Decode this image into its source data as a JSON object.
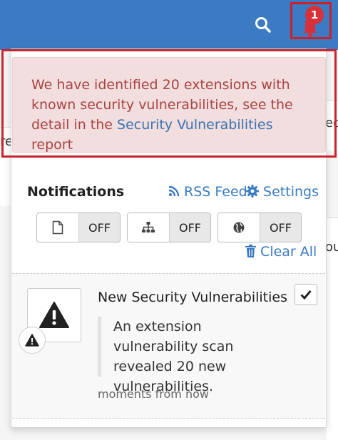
{
  "topbar": {
    "search_icon": "search-icon",
    "bell_icon": "bell-icon",
    "notification_count": "1",
    "accent": "#3a7bc3"
  },
  "background": {
    "fragment_right_top": "ed",
    "fragment_left": "re",
    "fragment_right_mid": "ou"
  },
  "alert": {
    "text_before": "We have identified 20 extensions with known security vulnerabilities, see the detail in the ",
    "link_text": "Security Vulnerabilities",
    "text_after": " report"
  },
  "notifications": {
    "title": "Notifications",
    "rss_label": "RSS Feed",
    "settings_label": "Settings",
    "toggles": [
      {
        "icon": "file-icon",
        "state": "OFF"
      },
      {
        "icon": "sitemap-icon",
        "state": "OFF"
      },
      {
        "icon": "globe-icon",
        "state": "OFF"
      }
    ],
    "clear_all_label": "Clear All",
    "items": [
      {
        "heading": "New Security Vulnerabilities",
        "body": "An extension vulnerability scan revealed 20 new vulnerabilities.",
        "time": "moments from now",
        "icon": "warning-icon"
      }
    ]
  }
}
